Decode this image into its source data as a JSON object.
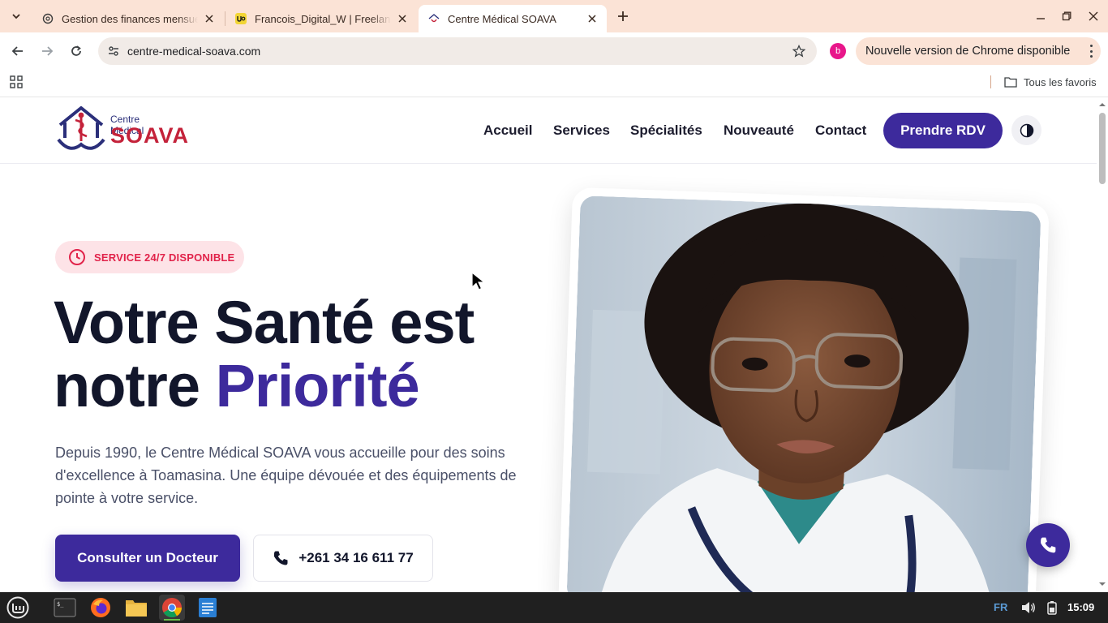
{
  "browser": {
    "tabs": [
      {
        "title": "Gestion des finances mensue",
        "favicon": "openai-icon",
        "active": false
      },
      {
        "title": "Francois_Digital_W | Freelan",
        "favicon": "upwork-icon",
        "active": false
      },
      {
        "title": "Centre Médical SOAVA",
        "favicon": "soava-icon",
        "active": true
      }
    ],
    "url": "centre-medical-soava.com",
    "profile_initial": "b",
    "update_notice": "Nouvelle version de Chrome disponible",
    "bookmarks_all": "Tous les favoris"
  },
  "site": {
    "logo": {
      "line1": "Centre Médical",
      "line2": "SOAVA"
    },
    "nav": [
      "Accueil",
      "Services",
      "Spécialités",
      "Nouveauté",
      "Contact"
    ],
    "cta_rdv": "Prendre RDV",
    "badge": "SERVICE 24/7 DISPONIBLE",
    "hero": {
      "title_line1": "Votre Santé est",
      "title_line2_prefix": "notre ",
      "title_line2_accent": "Priorité",
      "description": "Depuis 1990, le Centre Médical SOAVA vous accueille pour des soins d'excellence à Toamasina. Une équipe dévouée et des équipements de pointe à votre service.",
      "btn_primary": "Consulter un Docteur",
      "btn_phone": "+261 34 16 611 77"
    },
    "colors": {
      "primary": "#3d2a9c",
      "accent_red": "#e1234a",
      "badge_bg": "#fde3e7",
      "text_dark": "#12162b"
    }
  },
  "taskbar": {
    "apps": [
      "mint-menu-icon",
      "terminal-icon",
      "firefox-icon",
      "files-icon",
      "chrome-icon",
      "text-editor-icon"
    ],
    "lang": "FR",
    "clock": "15:09"
  }
}
